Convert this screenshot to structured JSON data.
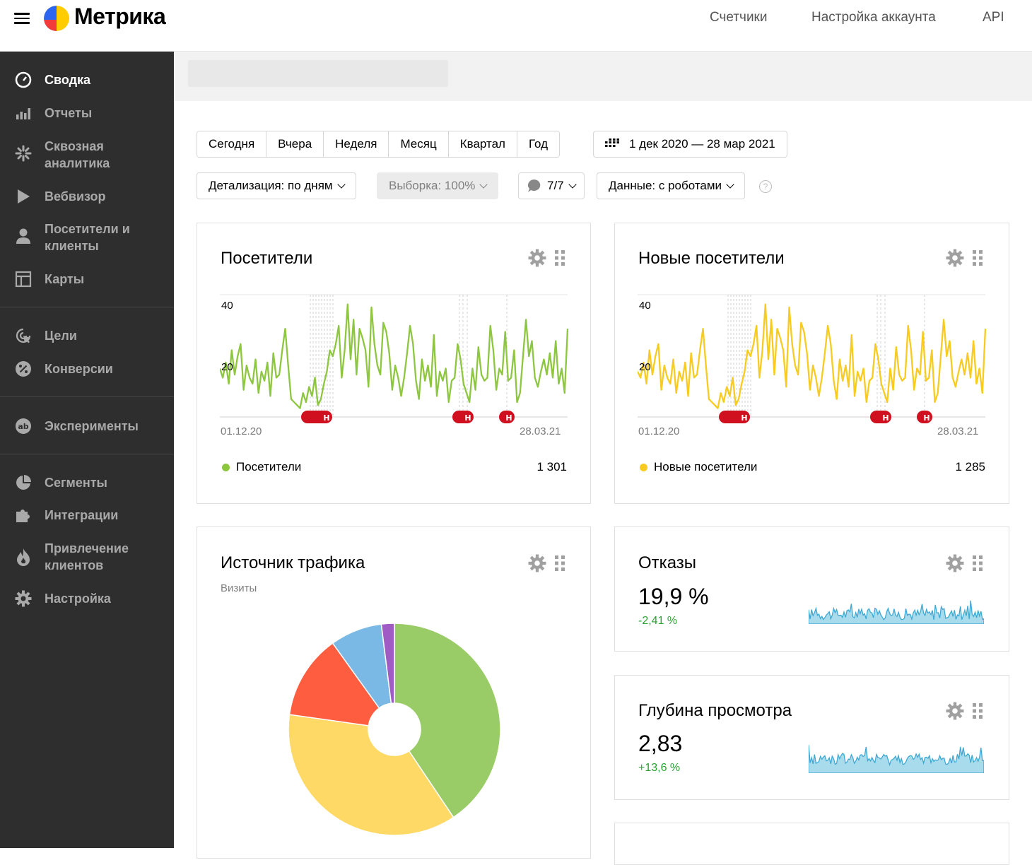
{
  "header": {
    "logo_text": "Метрика",
    "nav": [
      "Счетчики",
      "Настройка аккаунта",
      "API"
    ]
  },
  "sidebar": {
    "items": [
      {
        "label": "Сводка",
        "icon": "dashboard-icon",
        "active": true
      },
      {
        "label": "Отчеты",
        "icon": "bar-chart-icon"
      },
      {
        "label": "Сквозная аналитика",
        "icon": "sparkle-icon"
      },
      {
        "label": "Вебвизор",
        "icon": "play-icon"
      },
      {
        "label": "Посетители и клиенты",
        "icon": "person-icon"
      },
      {
        "label": "Карты",
        "icon": "map-layout-icon"
      },
      {
        "label": "Цели",
        "icon": "target-cursor-icon"
      },
      {
        "label": "Конверсии",
        "icon": "percent-icon"
      },
      {
        "label": "Эксперименты",
        "icon": "ab-icon"
      },
      {
        "label": "Сегменты",
        "icon": "pie-icon"
      },
      {
        "label": "Интеграции",
        "icon": "puzzle-icon"
      },
      {
        "label": "Привлечение клиентов",
        "icon": "flame-icon"
      },
      {
        "label": "Настройка",
        "icon": "gear-icon"
      }
    ]
  },
  "toolbar": {
    "periods": [
      "Сегодня",
      "Вчера",
      "Неделя",
      "Месяц",
      "Квартал",
      "Год"
    ],
    "date_range": "1 дек 2020 — 28 мар 2021",
    "detail": "Детализация: по дням",
    "sample": "Выборка: 100%",
    "attribution": "7/7",
    "robots": "Данные: с роботами",
    "help": "?"
  },
  "widgets": {
    "visitors": {
      "title": "Посетители",
      "y_ticks": [
        "40",
        "20"
      ],
      "date_start": "01.12.20",
      "date_end": "28.03.21",
      "legend": "Посетители",
      "total": "1 301",
      "color": "#8dc63f",
      "marker_label": "Н"
    },
    "new_visitors": {
      "title": "Новые посетители",
      "y_ticks": [
        "40",
        "20"
      ],
      "date_start": "01.12.20",
      "date_end": "28.03.21",
      "legend": "Новые посетители",
      "total": "1 285",
      "color": "#f7cb1f",
      "marker_label": "Н"
    },
    "traffic": {
      "title": "Источник трафика",
      "subtitle": "Визиты"
    },
    "bounce": {
      "title": "Отказы",
      "value": "19,9 %",
      "delta": "-2,41 %"
    },
    "depth": {
      "title": "Глубина просмотра",
      "value": "2,83",
      "delta": "+13,6 %"
    }
  },
  "chart_data": [
    {
      "type": "line",
      "series": [
        {
          "name": "Посетители",
          "values": [
            14,
            11,
            16,
            9,
            20,
            12,
            18,
            22,
            7,
            15,
            11,
            9,
            17,
            6,
            13,
            10,
            16,
            5,
            19,
            11,
            12,
            20,
            27,
            15,
            4,
            3,
            2,
            1,
            6,
            3,
            8,
            5,
            11,
            2,
            4,
            9,
            13,
            20,
            18,
            22,
            28,
            11,
            20,
            35,
            17,
            30,
            12,
            27,
            24,
            20,
            8,
            34,
            22,
            15,
            12,
            29,
            26,
            19,
            7,
            15,
            11,
            5,
            11,
            19,
            28,
            22,
            10,
            4,
            17,
            10,
            15,
            8,
            25,
            5,
            13,
            10,
            14,
            3,
            10,
            11,
            22,
            17,
            9,
            6,
            3,
            14,
            7,
            21,
            12,
            10,
            11,
            28,
            20,
            7,
            14,
            12,
            26,
            10,
            11,
            20,
            3,
            6,
            18,
            30,
            18,
            23,
            11,
            8,
            13,
            17,
            12,
            19,
            11,
            23,
            9,
            14,
            6,
            27
          ]
        }
      ],
      "y_ticks": [
        20,
        40
      ],
      "x_labels": [
        "01.12.20",
        "28.03.21"
      ]
    },
    {
      "type": "line",
      "series": [
        {
          "name": "Новые посетители",
          "values": [
            13,
            11,
            16,
            9,
            20,
            12,
            18,
            22,
            7,
            15,
            11,
            9,
            17,
            6,
            13,
            10,
            16,
            5,
            19,
            11,
            12,
            20,
            27,
            15,
            4,
            3,
            2,
            1,
            6,
            3,
            8,
            5,
            11,
            2,
            4,
            9,
            13,
            20,
            18,
            22,
            28,
            11,
            20,
            35,
            17,
            30,
            12,
            27,
            24,
            20,
            8,
            34,
            22,
            15,
            12,
            29,
            26,
            19,
            7,
            15,
            11,
            5,
            11,
            19,
            28,
            22,
            10,
            4,
            17,
            10,
            15,
            8,
            25,
            5,
            13,
            10,
            14,
            3,
            10,
            11,
            22,
            17,
            9,
            6,
            3,
            14,
            7,
            21,
            12,
            10,
            11,
            28,
            20,
            7,
            14,
            12,
            26,
            10,
            11,
            20,
            3,
            6,
            18,
            30,
            18,
            23,
            11,
            8,
            13,
            17,
            12,
            19,
            11,
            23,
            9,
            14,
            6,
            27
          ]
        }
      ],
      "y_ticks": [
        20,
        40
      ],
      "x_labels": [
        "01.12.20",
        "28.03.21"
      ]
    },
    {
      "type": "pie",
      "title": "Источник трафика",
      "slices": [
        {
          "value": 41,
          "color": "#99cc66"
        },
        {
          "value": 37,
          "color": "#fed966"
        },
        {
          "value": 13,
          "color": "#ff5d3f"
        },
        {
          "value": 8,
          "color": "#7ab9e6"
        },
        {
          "value": 2,
          "color": "#a05bc5"
        }
      ]
    }
  ]
}
